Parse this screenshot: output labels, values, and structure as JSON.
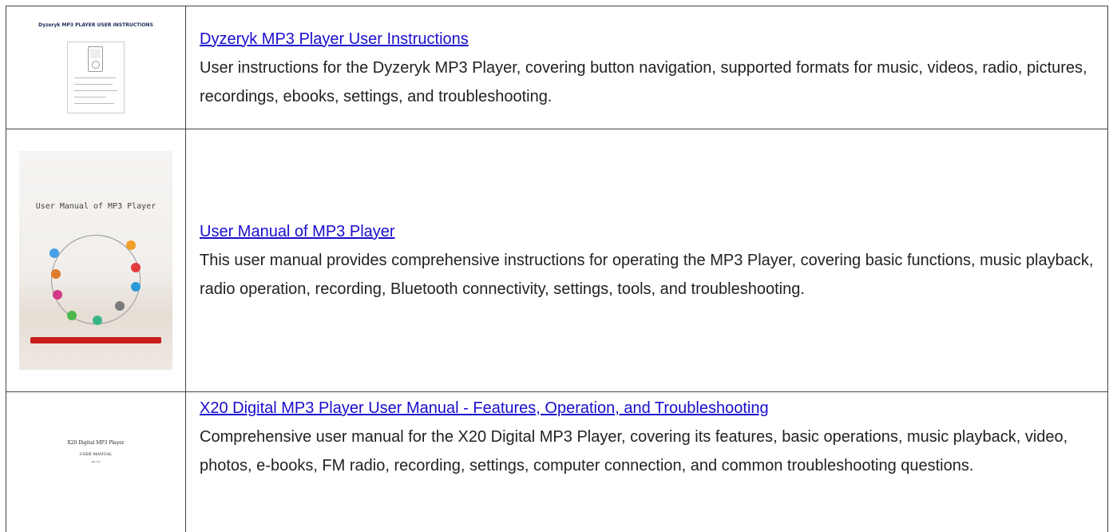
{
  "results": [
    {
      "title": "Dyzeryk MP3 Player User Instructions",
      "description": "User instructions for the Dyzeryk MP3 Player, covering button navigation, supported formats for music, videos, radio, pictures, recordings, ebooks, settings, and troubleshooting.",
      "thumbnail_caption": "Dyzeryk MP3 PLAYER USER INSTRUCTIONS"
    },
    {
      "title": "User Manual of MP3 Player",
      "description": "This user manual provides comprehensive instructions for operating the MP3 Player, covering basic functions, music playback, radio operation, recording, Bluetooth connectivity, settings, tools, and troubleshooting.",
      "thumbnail_caption": "User Manual of MP3 Player"
    },
    {
      "title": "X20 Digital MP3 Player User Manual - Features, Operation, and Troubleshooting",
      "description": "Comprehensive user manual for the X20 Digital MP3 Player, covering its features, basic operations, music playback, video, photos, e-books, FM radio, recording, settings, computer connection, and common troubleshooting questions.",
      "thumbnail_caption": "X20  Digital  MP3  Player",
      "thumbnail_subcaption": "USER MANUAL",
      "thumbnail_version": "Ver 1.0"
    }
  ],
  "colors": {
    "link": "#1a0dcc",
    "text": "#222222",
    "border": "#444444",
    "thumb2_bar": "#c81e1e"
  }
}
